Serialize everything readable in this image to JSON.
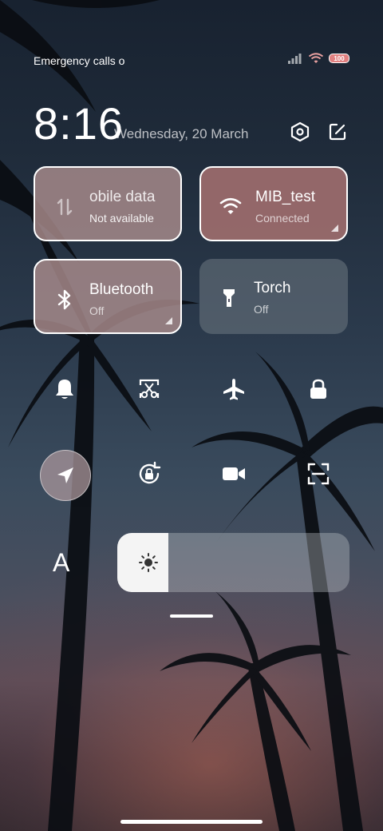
{
  "status_bar": {
    "carrier_text": "Emergency calls o",
    "battery_text": "100"
  },
  "header": {
    "time": "8:16",
    "date": "Wednesday, 20 March",
    "settings_icon": "settings-hexagon-icon",
    "edit_icon": "edit-icon"
  },
  "tiles": [
    {
      "title": "obile data",
      "subtitle": "Not available",
      "icon": "mobile-data-icon",
      "state": "on"
    },
    {
      "title": "MIB_test",
      "subtitle": "Connected",
      "icon": "wifi-icon",
      "state": "on"
    },
    {
      "title": "Bluetooth",
      "subtitle": "Off",
      "icon": "bluetooth-icon",
      "state": "on"
    },
    {
      "title": "Torch",
      "subtitle": "Off",
      "icon": "torch-icon",
      "state": "off"
    }
  ],
  "quick_toggles_row1": [
    {
      "icon": "bell-icon"
    },
    {
      "icon": "screenshot-scissors-icon"
    },
    {
      "icon": "airplane-icon"
    },
    {
      "icon": "lock-icon"
    }
  ],
  "quick_toggles_row2": [
    {
      "icon": "location-icon",
      "active": true
    },
    {
      "icon": "rotation-lock-icon"
    },
    {
      "icon": "video-camera-icon"
    },
    {
      "icon": "scan-icon"
    }
  ],
  "brightness": {
    "label": "A",
    "icon": "sun-icon",
    "level": 0.22
  }
}
